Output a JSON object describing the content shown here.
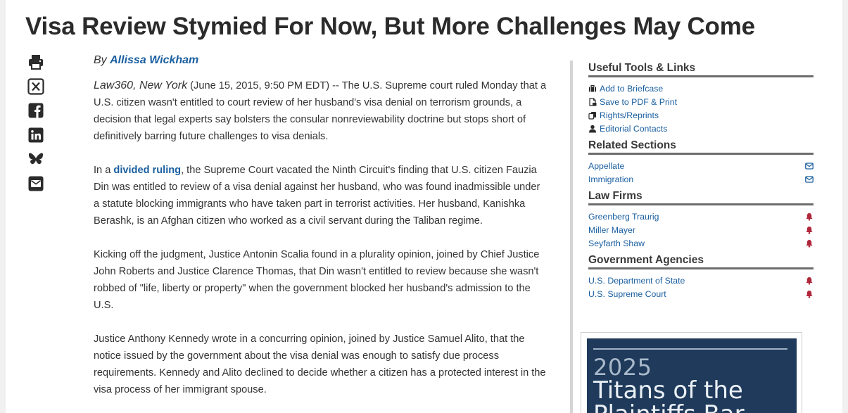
{
  "article": {
    "title": "Visa Review Stymied For Now, But More Challenges May Come",
    "byline_prefix": "By",
    "author": "Allissa Wickham",
    "dateline_source": "Law360, New York",
    "paragraphs": [
      {
        "lead": " (June 15, 2015, 9:50 PM EDT) -- The U.S. Supreme court ruled Monday that a U.S. citizen wasn't entitled to court review of her husband's visa denial on terrorism grounds, a decision that legal experts say bolsters the consular nonreviewability doctrine but stops short of definitively barring future challenges to visa denials."
      },
      {
        "before": "In a ",
        "link": "divided ruling",
        "after": ", the Supreme Court vacated the Ninth Circuit's finding that U.S. citizen Fauzia Din was entitled to review of a visa denial against her husband, who was found inadmissible under a statute blocking immigrants who have taken part in terrorist activities. Her husband, Kanishka Berashk, is an Afghan citizen who worked as a civil servant during the Taliban regime."
      },
      {
        "text": "Kicking off the judgment, Justice Antonin Scalia found in a plurality opinion, joined by Chief Justice John Roberts and Justice Clarence Thomas, that Din wasn't entitled to review because she wasn't robbed of \"life, liberty or property\" when the government blocked her husband's admission to the U.S."
      },
      {
        "text": "Justice Anthony Kennedy wrote in a concurring opinion, joined by Justice Samuel Alito, that the notice issued by the government about the visa denial was enough to satisfy due process requirements. Kennedy and Alito declined to decide whether a citizen has a protected interest in the visa process of her immigrant spouse."
      }
    ]
  },
  "share_icons": [
    "print-icon",
    "x-icon",
    "facebook-icon",
    "linkedin-icon",
    "bluesky-icon",
    "email-icon"
  ],
  "sidebar": {
    "tools": {
      "heading": "Useful Tools & Links",
      "items": [
        {
          "label": "Add to Briefcase",
          "icon": "briefcase-icon"
        },
        {
          "label": "Save to PDF & Print",
          "icon": "pdf-icon"
        },
        {
          "label": "Rights/Reprints",
          "icon": "copy-icon"
        },
        {
          "label": "Editorial Contacts",
          "icon": "user-icon"
        }
      ]
    },
    "sections": {
      "heading": "Related Sections",
      "items": [
        {
          "label": "Appellate",
          "trail_icon": "envelope-icon"
        },
        {
          "label": "Immigration",
          "trail_icon": "envelope-icon"
        }
      ]
    },
    "firms": {
      "heading": "Law Firms",
      "items": [
        {
          "label": "Greenberg Traurig",
          "trail_icon": "bell-icon"
        },
        {
          "label": "Miller Mayer",
          "trail_icon": "bell-icon"
        },
        {
          "label": "Seyfarth Shaw",
          "trail_icon": "bell-icon"
        }
      ]
    },
    "agencies": {
      "heading": "Government Agencies",
      "items": [
        {
          "label": "U.S. Department of State",
          "trail_icon": "bell-icon"
        },
        {
          "label": "U.S. Supreme Court",
          "trail_icon": "bell-icon"
        }
      ]
    }
  },
  "promo": {
    "year": "2025",
    "line1": "Titans of the",
    "line2": "Plaintiffs Bar"
  },
  "colors": {
    "link": "#1a5fa0",
    "bell": "#b0263a",
    "promo_bg": "#1f3a5a"
  }
}
